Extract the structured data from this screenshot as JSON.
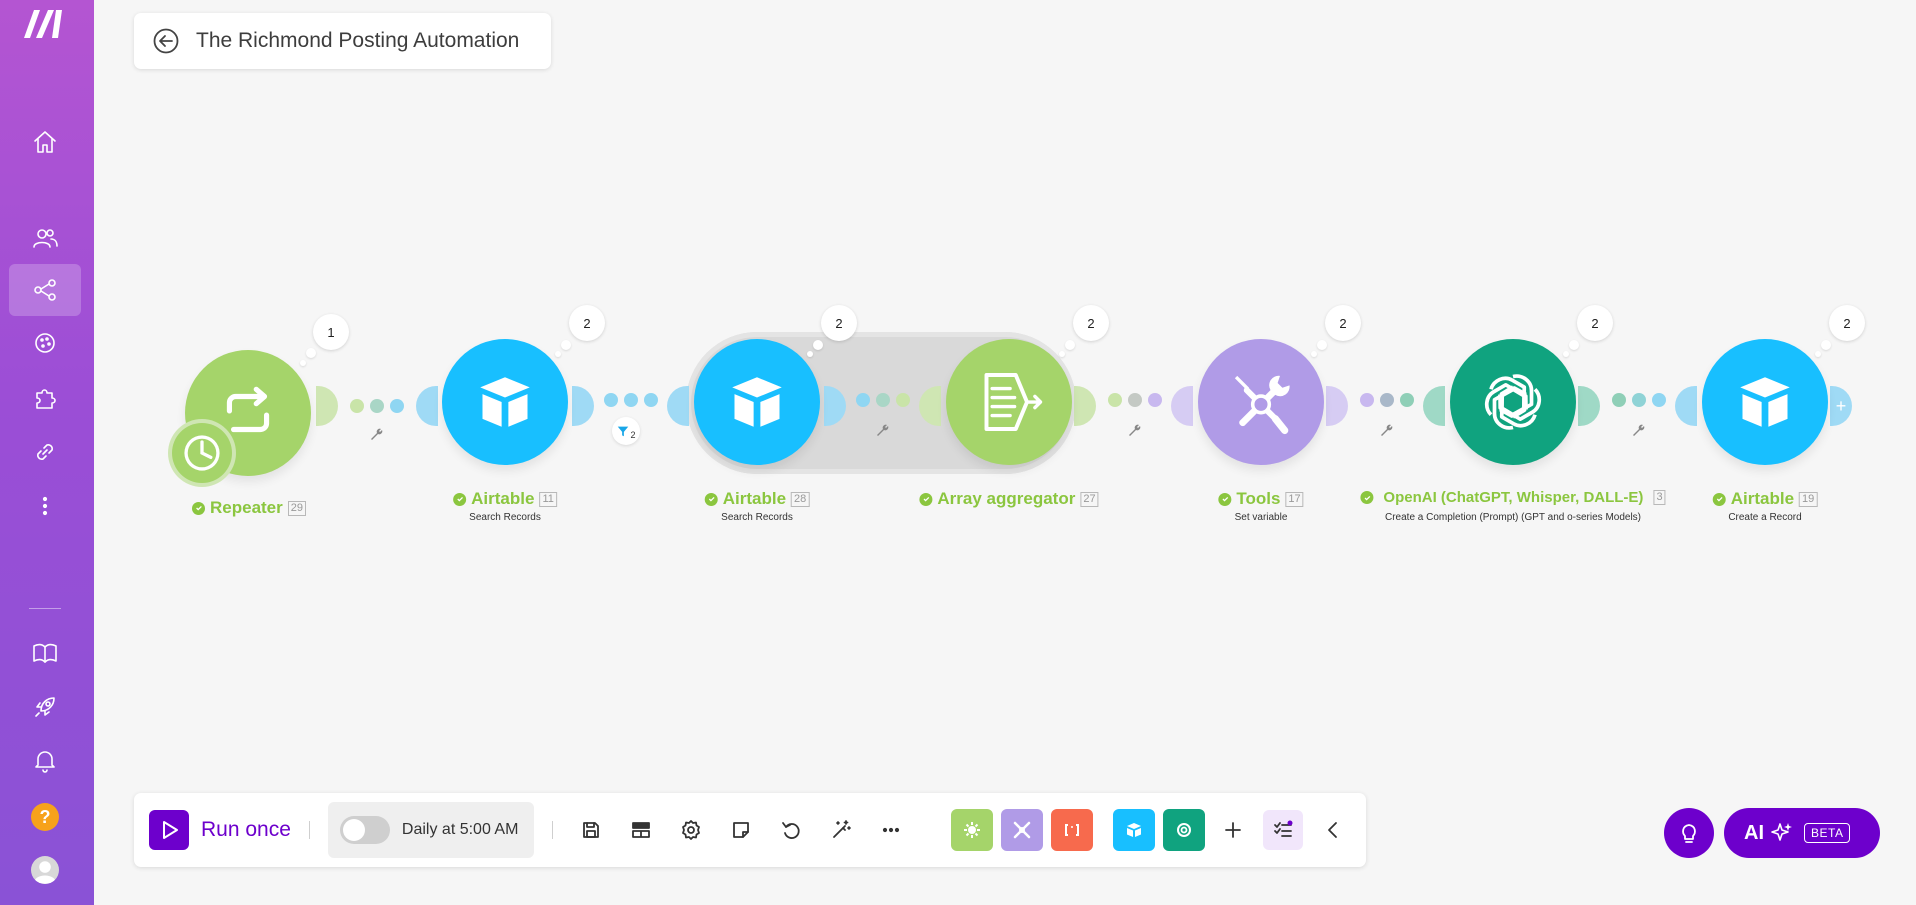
{
  "app": {
    "title": "The Richmond Posting Automation"
  },
  "sidebar": {
    "items": [
      {
        "icon": "home-icon"
      },
      {
        "icon": "team-icon"
      },
      {
        "icon": "scenarios-icon",
        "active": true
      },
      {
        "icon": "templates-icon"
      },
      {
        "icon": "apps-icon"
      },
      {
        "icon": "connections-icon"
      },
      {
        "icon": "more-icon"
      },
      {
        "icon": "docs-icon"
      },
      {
        "icon": "rocket-icon"
      },
      {
        "icon": "bell-icon"
      },
      {
        "icon": "help-icon",
        "text": "?"
      },
      {
        "icon": "avatar"
      }
    ]
  },
  "modules": [
    {
      "name": "Repeater",
      "id": "29",
      "subtitle": "",
      "ops": "1",
      "color": "#a5d46a"
    },
    {
      "name": "Airtable",
      "id": "11",
      "subtitle": "Search Records",
      "ops": "2",
      "color": "#18bfff"
    },
    {
      "name": "Airtable",
      "id": "28",
      "subtitle": "Search Records",
      "ops": "2",
      "color": "#18bfff"
    },
    {
      "name": "Array aggregator",
      "id": "27",
      "subtitle": "",
      "ops": "2",
      "color": "#a5d46a"
    },
    {
      "name": "Tools",
      "id": "17",
      "subtitle": "Set variable",
      "ops": "2",
      "color": "#b09be7"
    },
    {
      "name": "OpenAI (ChatGPT, Whisper, DALL-E)",
      "id": "3",
      "subtitle": "Create a Completion (Prompt) (GPT and o-series Models)",
      "ops": "2",
      "color": "#10a37f"
    },
    {
      "name": "Airtable",
      "id": "19",
      "subtitle": "Create a Record",
      "ops": "2",
      "color": "#18bfff"
    }
  ],
  "filter_badge": {
    "count": "2"
  },
  "toolbar": {
    "run_label": "Run once",
    "schedule_label": "Daily at 5:00 AM",
    "schedule_on": false,
    "tools": [
      "save-icon",
      "auto-align-icon",
      "settings-icon",
      "notes-icon",
      "undo-icon",
      "magic-wand-icon",
      "more-dots-icon"
    ],
    "favorites": [
      {
        "icon": "flow-control-icon",
        "color": "#a5d46a"
      },
      {
        "icon": "tools-icon",
        "color": "#b09be7"
      },
      {
        "icon": "json-icon",
        "color": "#f76a4d"
      },
      {
        "icon": "airtable-icon",
        "color": "#18bfff"
      },
      {
        "icon": "openai-icon",
        "color": "#10a37f"
      }
    ]
  },
  "ai": {
    "label": "AI",
    "badge": "BETA"
  },
  "colors": {
    "accent": "#6d00cc"
  }
}
